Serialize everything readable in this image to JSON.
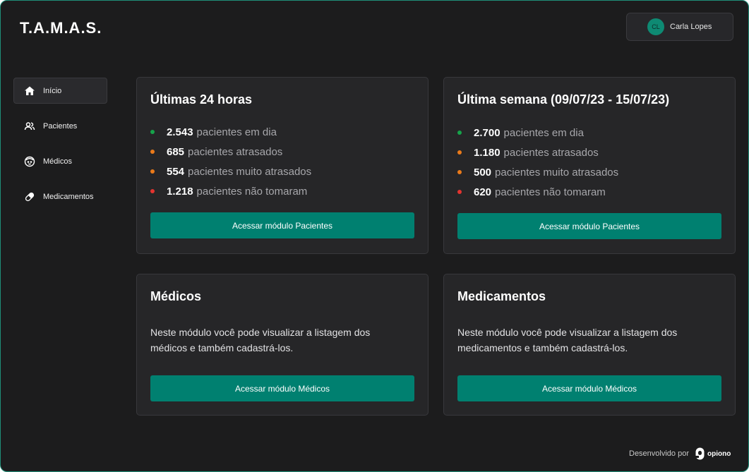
{
  "app": {
    "logo": "T.A.M.A.S."
  },
  "user": {
    "initials": "CL",
    "name": "Carla Lopes"
  },
  "sidebar": {
    "items": [
      {
        "label": "Início",
        "icon": "home-icon",
        "active": true
      },
      {
        "label": "Pacientes",
        "icon": "users-icon",
        "active": false
      },
      {
        "label": "Médicos",
        "icon": "doctor-face-icon",
        "active": false
      },
      {
        "label": "Medicamentos",
        "icon": "pill-icon",
        "active": false
      }
    ]
  },
  "colors": {
    "green": "#16a34a",
    "orange": "#ea7a1a",
    "red": "#e3342f",
    "accent": "#008070"
  },
  "cards": {
    "last24": {
      "title": "Últimas 24 horas",
      "stats": [
        {
          "value": "2.543",
          "label": "pacientes em dia",
          "status": "green"
        },
        {
          "value": "685",
          "label": "pacientes atrasados",
          "status": "orange"
        },
        {
          "value": "554",
          "label": "pacientes muito atrasados",
          "status": "orange"
        },
        {
          "value": "1.218",
          "label": "pacientes não tomaram",
          "status": "red"
        }
      ],
      "button": "Acessar módulo Pacientes"
    },
    "week": {
      "title": "Última semana (09/07/23  - 15/07/23)",
      "stats": [
        {
          "value": "2.700",
          "label": "pacientes em dia",
          "status": "green"
        },
        {
          "value": "1.180",
          "label": "pacientes atrasados",
          "status": "orange"
        },
        {
          "value": "500",
          "label": "pacientes muito atrasados",
          "status": "orange"
        },
        {
          "value": "620",
          "label": "pacientes não tomaram",
          "status": "red"
        }
      ],
      "button": "Acessar módulo Pacientes"
    },
    "doctors": {
      "title": "Médicos",
      "description": "Neste módulo você pode visualizar a listagem dos médicos e também cadastrá-los.",
      "button": "Acessar módulo Médicos"
    },
    "medications": {
      "title": "Medicamentos",
      "description": "Neste módulo você pode visualizar a listagem dos medicamentos e também cadastrá-los.",
      "button": "Acessar módulo Médicos"
    }
  },
  "footer": {
    "label": "Desenvolvido por",
    "brand": "opiono"
  }
}
